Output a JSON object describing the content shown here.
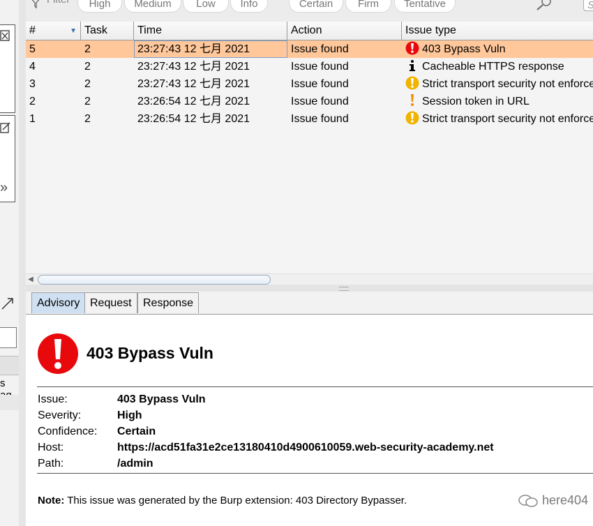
{
  "filter": {
    "label": "Filter",
    "severity": [
      "High",
      "Medium",
      "Low",
      "Info"
    ],
    "confidence": [
      "Certain",
      "Firm",
      "Tentative"
    ],
    "search_placeholder": "Search"
  },
  "table": {
    "columns": [
      "#",
      "Task",
      "Time",
      "Action",
      "Issue type"
    ],
    "rows": [
      {
        "num": "5",
        "task": "2",
        "time": "23:27:43 12 七月 2021",
        "action": "Issue found",
        "issue": "403 Bypass Vuln",
        "icon": "high-severity-icon",
        "icon_color": "#e8090d"
      },
      {
        "num": "4",
        "task": "2",
        "time": "23:27:43 12 七月 2021",
        "action": "Issue found",
        "issue": "Cacheable HTTPS response",
        "icon": "info-icon",
        "icon_color": "#000000"
      },
      {
        "num": "3",
        "task": "2",
        "time": "23:27:43 12 七月 2021",
        "action": "Issue found",
        "issue": "Strict transport security not enforced",
        "icon": "low-severity-icon",
        "icon_color": "#f0b400"
      },
      {
        "num": "2",
        "task": "2",
        "time": "23:26:54 12 七月 2021",
        "action": "Issue found",
        "issue": "Session token in URL",
        "icon": "medium-severity-icon",
        "icon_color": "#f08c00"
      },
      {
        "num": "1",
        "task": "2",
        "time": "23:26:54 12 七月 2021",
        "action": "Issue found",
        "issue": "Strict transport security not enforced",
        "icon": "low-severity-icon",
        "icon_color": "#f0b400"
      }
    ],
    "selected_row": "5",
    "selected_color": "#ffc79a"
  },
  "tabs": [
    "Advisory",
    "Request",
    "Response"
  ],
  "advisory": {
    "title": "403 Bypass Vuln",
    "fields": [
      {
        "label": "Issue:",
        "value": "403 Bypass Vuln"
      },
      {
        "label": "Severity:",
        "value": "High"
      },
      {
        "label": "Confidence:",
        "value": "Certain"
      },
      {
        "label": "Host:",
        "value": "https://acd51fa31e2ce13180410d4900610059.web-security-academy.net"
      },
      {
        "label": "Path:",
        "value": "/admin"
      }
    ],
    "note_label": "Note:",
    "note_text": " This issue was generated by the Burp extension: 403 Directory Bypasser."
  },
  "left_panel": {
    "fragment_text": "s ag"
  },
  "watermark": "here404",
  "colors": {
    "high": "#e8090d",
    "tab_active": "#cfe0f2"
  }
}
